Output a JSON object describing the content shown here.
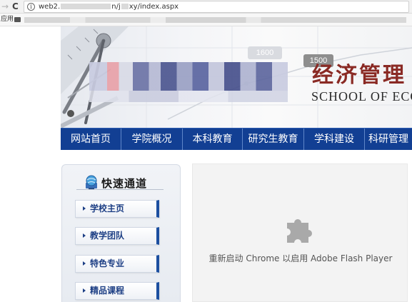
{
  "browser": {
    "url_prefix": "web2.",
    "url_mid": "n/j",
    "url_suffix": "xy/index.aspx",
    "apps_label": "应用"
  },
  "banner": {
    "school_name_cn": "经济管理",
    "school_name_en": "SCHOOL OF  ECO",
    "tag_left": "1600",
    "tag_right": "1500"
  },
  "mainnav": {
    "items": [
      "网站首页",
      "学院概况",
      "本科教育",
      "研究生教育",
      "学科建设",
      "科研管理"
    ]
  },
  "sidebar": {
    "title": "快速通道",
    "buttons": [
      "学校主页",
      "教学团队",
      "特色专业",
      "精品课程"
    ]
  },
  "flash": {
    "message": "重新启动 Chrome 以启用 Adobe Flash Player",
    "icon": "puzzle-plugin-icon"
  },
  "colors": {
    "nav_bg": "#123f93",
    "title_red": "#8a2a24",
    "button_accent": "#1c4fa0"
  }
}
